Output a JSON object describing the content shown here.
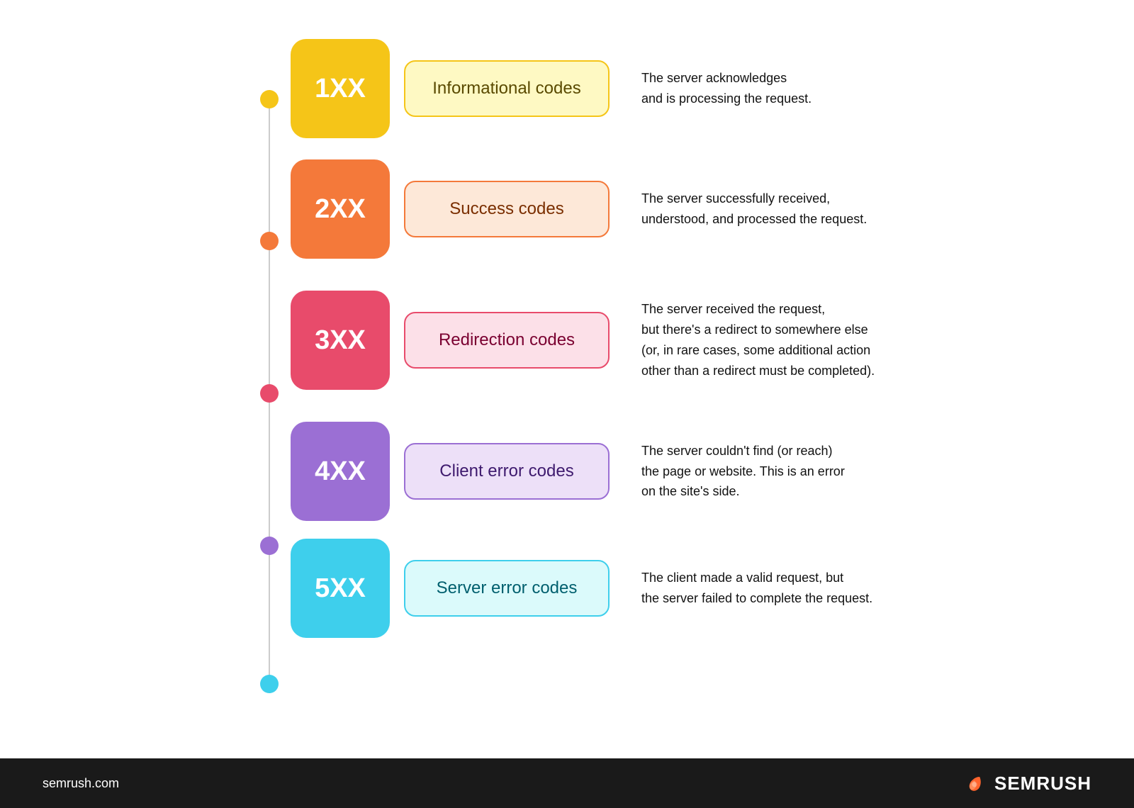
{
  "rows": [
    {
      "id": "1xx",
      "code": "1XX",
      "label": "Informational codes",
      "description": "The server acknowledges\nand is processing the request.",
      "dot_color": "#F5C518",
      "code_bg": "#F5C518",
      "label_bg": "#FEF9C3",
      "label_border": "#F5C518",
      "label_color": "#5a4a00",
      "row_class": "row-1"
    },
    {
      "id": "2xx",
      "code": "2XX",
      "label": "Success codes",
      "description": "The server successfully received,\nunderstood, and processed the request.",
      "dot_color": "#F4793A",
      "code_bg": "#F4793A",
      "label_bg": "#FDE8D8",
      "label_border": "#F4793A",
      "label_color": "#7a2e00",
      "row_class": "row-2"
    },
    {
      "id": "3xx",
      "code": "3XX",
      "label": "Redirection codes",
      "description": "The server received the request,\nbut there's a redirect to somewhere else\n(or, in rare cases, some additional action\nother than a redirect must be completed).",
      "dot_color": "#E84B6B",
      "code_bg": "#E84B6B",
      "label_bg": "#FCE0E8",
      "label_border": "#E84B6B",
      "label_color": "#7a0030",
      "row_class": "row-3"
    },
    {
      "id": "4xx",
      "code": "4XX",
      "label": "Client error codes",
      "description": "The server couldn't find (or reach)\nthe page or website. This is an error\non the site's side.",
      "dot_color": "#9B6FD4",
      "code_bg": "#9B6FD4",
      "label_bg": "#EDE0F8",
      "label_border": "#9B6FD4",
      "label_color": "#3e1a6e",
      "row_class": "row-4"
    },
    {
      "id": "5xx",
      "code": "5XX",
      "label": "Server error codes",
      "description": "The client made a valid request, but\nthe server failed to complete the request.",
      "dot_color": "#3ECFEC",
      "code_bg": "#3ECFEC",
      "label_bg": "#DBFAFB",
      "label_border": "#3ECFEC",
      "label_color": "#005f6e",
      "row_class": "row-5"
    }
  ],
  "footer": {
    "url": "semrush.com",
    "brand": "SEMRUSH"
  }
}
